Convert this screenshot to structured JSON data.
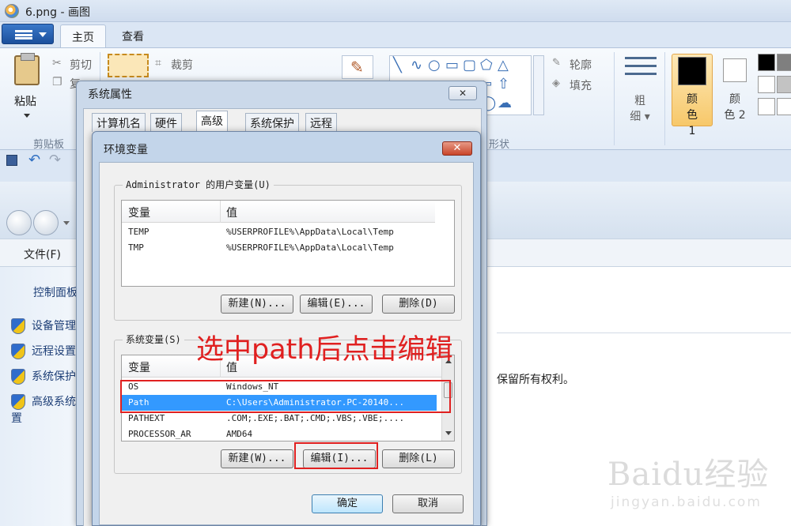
{
  "window": {
    "title": "6.png - 画图"
  },
  "ribbon": {
    "tabs": [
      "主页",
      "查看"
    ],
    "paste_label": "粘贴",
    "cut_label": "剪切",
    "copy_label": "复",
    "crop_label": "裁剪",
    "outline_label": "轮廓",
    "fill_label": "填充",
    "size_label": "粗\n细",
    "color1_label": "颜\n色 1",
    "color2_label": "颜\n色 2",
    "clipboard_group_label": "剪贴板",
    "shapes_group_label": "形状",
    "accent_color": "#f7c86a"
  },
  "control_panel": {
    "file_menu": "文件(F)",
    "home_link": "控制面板",
    "links": [
      "设备管理器",
      "远程设置",
      "系统保护",
      "高级系统设置"
    ],
    "copyright": "保留所有权利。"
  },
  "system_properties": {
    "title": "系统属性",
    "close_glyph": "✕",
    "tabs": [
      "计算机名",
      "硬件",
      "高级",
      "系统保护",
      "远程"
    ],
    "active_tab": "高级"
  },
  "env_dialog": {
    "title": "环境变量",
    "close_glyph": "✕",
    "user_vars_label": "Administrator 的用户变量(U)",
    "col_var": "变量",
    "col_value": "值",
    "user_vars": [
      {
        "name": "TEMP",
        "value": "%USERPROFILE%\\AppData\\Local\\Temp"
      },
      {
        "name": "TMP",
        "value": "%USERPROFILE%\\AppData\\Local\\Temp"
      }
    ],
    "user_buttons": {
      "new": "新建(N)...",
      "edit": "编辑(E)...",
      "delete": "删除(D)"
    },
    "system_vars_label": "系统变量(S)",
    "system_vars": [
      {
        "name": "OS",
        "value": "Windows_NT"
      },
      {
        "name": "Path",
        "value": "C:\\Users\\Administrator.PC-20140...",
        "selected": true
      },
      {
        "name": "PATHEXT",
        "value": ".COM;.EXE;.BAT;.CMD;.VBS;.VBE;...."
      },
      {
        "name": "PROCESSOR_AR",
        "value": "AMD64"
      }
    ],
    "system_buttons": {
      "new": "新建(W)...",
      "edit": "编辑(I)...",
      "delete": "删除(L)"
    },
    "ok": "确定",
    "cancel": "取消"
  },
  "annotation": {
    "text": "选中path后点击编辑",
    "color": "#e02020"
  },
  "watermark": {
    "logo": "Baidu经验",
    "url": "jingyan.baidu.com"
  }
}
